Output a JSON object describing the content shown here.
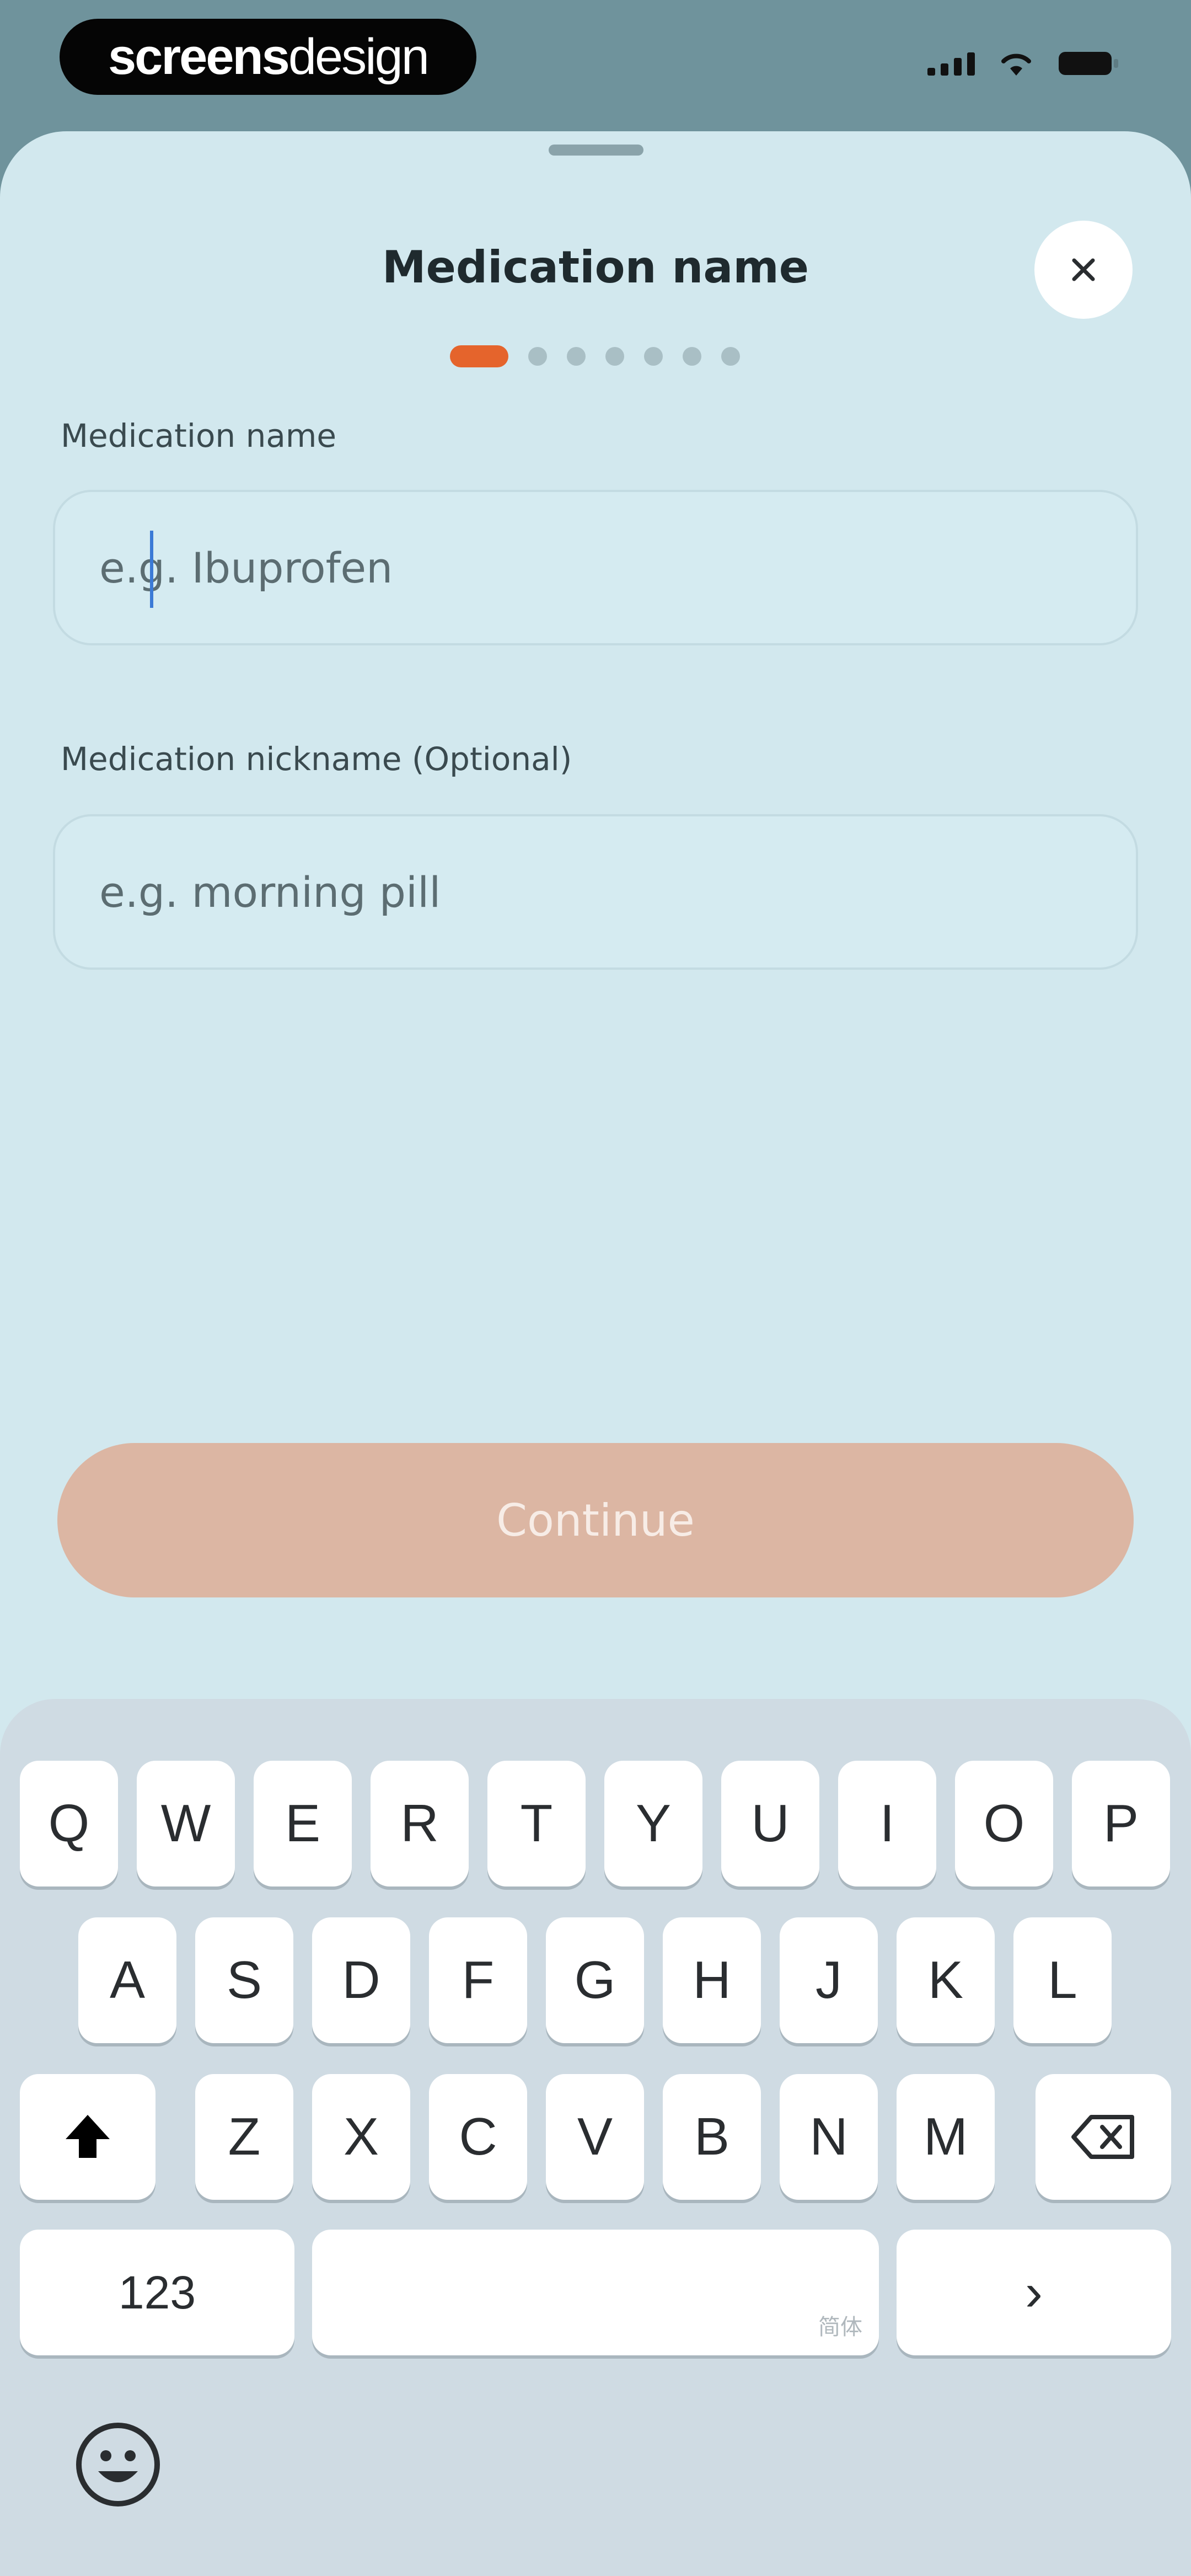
{
  "status_bar": {
    "brand_bold": "screens",
    "brand_light": "design"
  },
  "sheet": {
    "title": "Medication name",
    "close_icon": "close-icon",
    "stepper": {
      "total_steps": 7,
      "current_step": 1
    }
  },
  "form": {
    "medication_name": {
      "label": "Medication name",
      "value": "",
      "placeholder": "e.g. Ibuprofen"
    },
    "medication_nickname": {
      "label": "Medication nickname (Optional)",
      "value": "",
      "placeholder": "e.g. morning pill"
    }
  },
  "continue_button": {
    "label": "Continue",
    "enabled": false
  },
  "keyboard": {
    "row1": [
      "Q",
      "W",
      "E",
      "R",
      "T",
      "Y",
      "U",
      "I",
      "O",
      "P"
    ],
    "row2": [
      "A",
      "S",
      "D",
      "F",
      "G",
      "H",
      "J",
      "K",
      "L"
    ],
    "row3": [
      "Z",
      "X",
      "C",
      "V",
      "B",
      "N",
      "M"
    ],
    "shift_icon": "shift-icon",
    "backspace_icon": "backspace-icon",
    "numbers_label": "123",
    "space_hint": "简体",
    "return_label": "›",
    "emoji_icon": "emoji-icon"
  },
  "colors": {
    "accent": "#e5642c",
    "button_disabled": "#dcb6a3",
    "sheet_background": "#d2e8ee",
    "backdrop": "#6f939c"
  }
}
